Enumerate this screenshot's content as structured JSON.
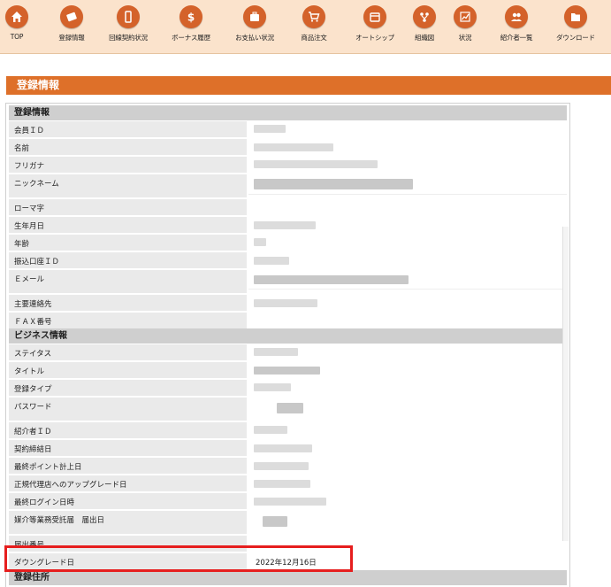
{
  "nav": {
    "items": [
      {
        "label": "TOP",
        "icon": "home-icon"
      },
      {
        "label": "登録情報",
        "icon": "edit-icon"
      },
      {
        "label": "回線契約状況",
        "icon": "smartphone-icon"
      },
      {
        "label": "ボーナス履歴",
        "icon": "dollar-icon"
      },
      {
        "label": "お支払い状況",
        "icon": "wallet-icon"
      },
      {
        "label": "商品注文",
        "icon": "cart-icon"
      },
      {
        "label": "オートシップ",
        "icon": "calendar-icon"
      },
      {
        "label": "組織図",
        "icon": "org-chart-icon"
      },
      {
        "label": "状況",
        "icon": "trend-chart-icon"
      },
      {
        "label": "紹介者一覧",
        "icon": "users-icon"
      },
      {
        "label": "ダウンロード",
        "icon": "download-folder-icon"
      }
    ]
  },
  "page_title": "登録情報",
  "sections": {
    "registration": {
      "title": "登録情報",
      "rows": [
        {
          "label": "会員ＩＤ",
          "value": ""
        },
        {
          "label": "名前",
          "value": ""
        },
        {
          "label": "フリガナ",
          "value": ""
        },
        {
          "label": "ニックネーム",
          "value": ""
        },
        {
          "label": "ローマ字",
          "value": ""
        },
        {
          "label": "生年月日",
          "value": ""
        },
        {
          "label": "年齢",
          "value": ""
        },
        {
          "label": "振込口座ＩＤ",
          "value": ""
        },
        {
          "label": "Ｅメール",
          "value": ""
        },
        {
          "label": "主要連絡先",
          "value": ""
        },
        {
          "label": "ＦＡＸ番号",
          "value": ""
        }
      ]
    },
    "business": {
      "title": "ビジネス情報",
      "rows": [
        {
          "label": "ステイタス",
          "value": ""
        },
        {
          "label": "タイトル",
          "value": ""
        },
        {
          "label": "登録タイプ",
          "value": ""
        },
        {
          "label": "パスワード",
          "value": ""
        },
        {
          "label": "紹介者ＩＤ",
          "value": ""
        },
        {
          "label": "契約締結日",
          "value": ""
        },
        {
          "label": "最終ポイント計上日",
          "value": ""
        },
        {
          "label": "正規代理店へのアップグレード日",
          "value": ""
        },
        {
          "label": "最終ログイン日時",
          "value": ""
        },
        {
          "label": "媒介等業務受託届　届出日",
          "value": ""
        },
        {
          "label": "届出番号",
          "value": ""
        },
        {
          "label": "ダウングレード日",
          "value": "2022年12月16日"
        }
      ]
    },
    "address": {
      "title": "登録住所"
    }
  }
}
